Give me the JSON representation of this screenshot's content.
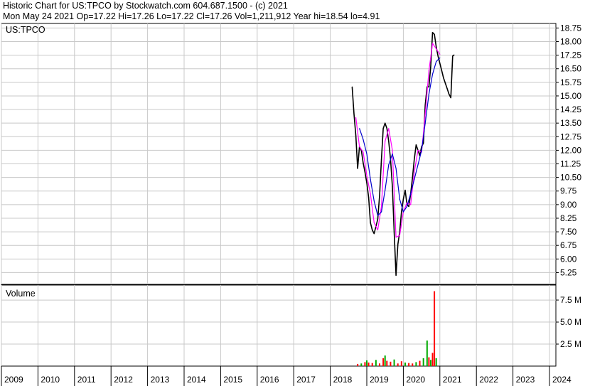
{
  "header": {
    "line1": "Historic Chart for US:TPCO by Stockwatch.com 604.687.1500 - (c) 2021",
    "line2": "Mon May 24 2021   Op=17.22   Hi=17.26   Lo=17.22   Cl=17.26   Vol=1,211,912   Year hi=18.54   lo=4.91"
  },
  "colors": {
    "price": "#000000",
    "ma_short": "#ff00ff",
    "ma_long": "#0000cc",
    "volume_up": "#00aa00",
    "volume_down": "#ff0000",
    "grid": "#c8c8c8"
  },
  "chart_data": [
    {
      "type": "line",
      "panel_label": "US:TPCO",
      "y_axis_side": "right",
      "ylim": [
        4.6,
        19.0
      ],
      "y_ticks": [
        "18.75",
        "18.00",
        "17.25",
        "16.50",
        "15.75",
        "15.00",
        "14.25",
        "13.50",
        "12.75",
        "12.00",
        "11.25",
        "10.50",
        "9.75",
        "9.00",
        "8.25",
        "7.50",
        "6.75",
        "6.00",
        "5.25"
      ],
      "x_ticks": [
        "2009",
        "2010",
        "2011",
        "2012",
        "2013",
        "2014",
        "2015",
        "2016",
        "2017",
        "2018",
        "2019",
        "2020",
        "2021",
        "2022",
        "2023",
        "2024"
      ],
      "grid": true,
      "series": [
        {
          "role": "price",
          "x": [
            2018.6,
            2018.65,
            2018.7,
            2018.75,
            2018.8,
            2018.85,
            2018.9,
            2018.95,
            2019.0,
            2019.05,
            2019.1,
            2019.15,
            2019.2,
            2019.25,
            2019.3,
            2019.35,
            2019.4,
            2019.45,
            2019.5,
            2019.55,
            2019.6,
            2019.65,
            2019.7,
            2019.75,
            2019.8,
            2019.85,
            2019.9,
            2019.95,
            2020.0,
            2020.05,
            2020.1,
            2020.15,
            2020.2,
            2020.25,
            2020.3,
            2020.35,
            2020.4,
            2020.45,
            2020.5,
            2020.55,
            2020.6,
            2020.65,
            2020.7,
            2020.75,
            2020.8,
            2020.85,
            2020.9,
            2020.95,
            2021.0,
            2021.05,
            2021.1,
            2021.15,
            2021.2,
            2021.25,
            2021.3,
            2021.35,
            2021.39
          ],
          "values": [
            15.5,
            14.0,
            12.8,
            11.0,
            12.2,
            12.0,
            11.3,
            10.8,
            10.2,
            9.4,
            8.0,
            7.6,
            7.4,
            7.8,
            8.2,
            9.5,
            11.5,
            13.2,
            13.5,
            13.2,
            12.5,
            11.5,
            10.0,
            7.5,
            5.1,
            6.8,
            7.5,
            8.6,
            9.3,
            9.8,
            9.0,
            8.9,
            9.6,
            10.5,
            11.5,
            12.3,
            12.0,
            11.7,
            12.2,
            12.4,
            14.5,
            15.5,
            15.5,
            16.6,
            18.5,
            18.4,
            17.7,
            17.2,
            16.8,
            16.4,
            16.0,
            15.7,
            15.4,
            15.1,
            14.9,
            17.2,
            17.26
          ]
        },
        {
          "role": "moving_average_short",
          "x": [
            2018.7,
            2018.8,
            2018.9,
            2019.0,
            2019.1,
            2019.2,
            2019.3,
            2019.4,
            2019.5,
            2019.6,
            2019.7,
            2019.8,
            2019.9,
            2020.0,
            2020.1,
            2020.2,
            2020.3,
            2020.4,
            2020.5,
            2020.6,
            2020.7,
            2020.8,
            2020.9,
            2021.0
          ],
          "values": [
            13.8,
            12.2,
            11.9,
            10.6,
            9.6,
            8.0,
            7.6,
            8.9,
            12.5,
            13.2,
            12.0,
            7.2,
            7.3,
            8.6,
            9.1,
            9.0,
            10.8,
            12.0,
            11.9,
            14.0,
            16.4,
            17.9,
            17.6,
            17.3
          ]
        },
        {
          "role": "moving_average_long",
          "x": [
            2018.8,
            2018.9,
            2019.0,
            2019.1,
            2019.2,
            2019.3,
            2019.4,
            2019.5,
            2019.6,
            2019.7,
            2019.8,
            2019.9,
            2020.0,
            2020.1,
            2020.2,
            2020.3,
            2020.4,
            2020.5,
            2020.6,
            2020.7,
            2020.8,
            2020.9,
            2021.0
          ],
          "values": [
            13.2,
            12.6,
            11.8,
            10.4,
            9.2,
            8.4,
            8.6,
            9.8,
            11.2,
            11.8,
            11.0,
            9.3,
            8.6,
            8.9,
            9.6,
            10.4,
            11.2,
            12.0,
            13.5,
            15.1,
            16.2,
            16.9,
            17.1
          ]
        }
      ]
    },
    {
      "type": "bar",
      "panel_label": "Volume",
      "y_axis_side": "right",
      "ylim": [
        0,
        9200000
      ],
      "y_ticks": [
        "7.5 M",
        "5.0 M",
        "2.5 M"
      ],
      "x": [
        2018.75,
        2018.85,
        2018.95,
        2019.0,
        2019.05,
        2019.15,
        2019.25,
        2019.35,
        2019.45,
        2019.5,
        2019.55,
        2019.65,
        2019.75,
        2019.85,
        2019.95,
        2020.05,
        2020.15,
        2020.25,
        2020.35,
        2020.45,
        2020.55,
        2020.65,
        2020.7,
        2020.75,
        2020.8,
        2020.85,
        2020.9
      ],
      "values": [
        250000,
        300000,
        450000,
        650000,
        400000,
        350000,
        700000,
        300000,
        900000,
        1200000,
        600000,
        500000,
        750000,
        300000,
        550000,
        400000,
        350000,
        300000,
        450000,
        600000,
        900000,
        2900000,
        1000000,
        700000,
        1500000,
        8500000,
        900000
      ],
      "directions": [
        "down",
        "up",
        "down",
        "up",
        "down",
        "down",
        "up",
        "down",
        "down",
        "up",
        "down",
        "down",
        "up",
        "down",
        "down",
        "up",
        "down",
        "down",
        "up",
        "down",
        "up",
        "up",
        "down",
        "up",
        "down",
        "down",
        "up"
      ]
    }
  ]
}
